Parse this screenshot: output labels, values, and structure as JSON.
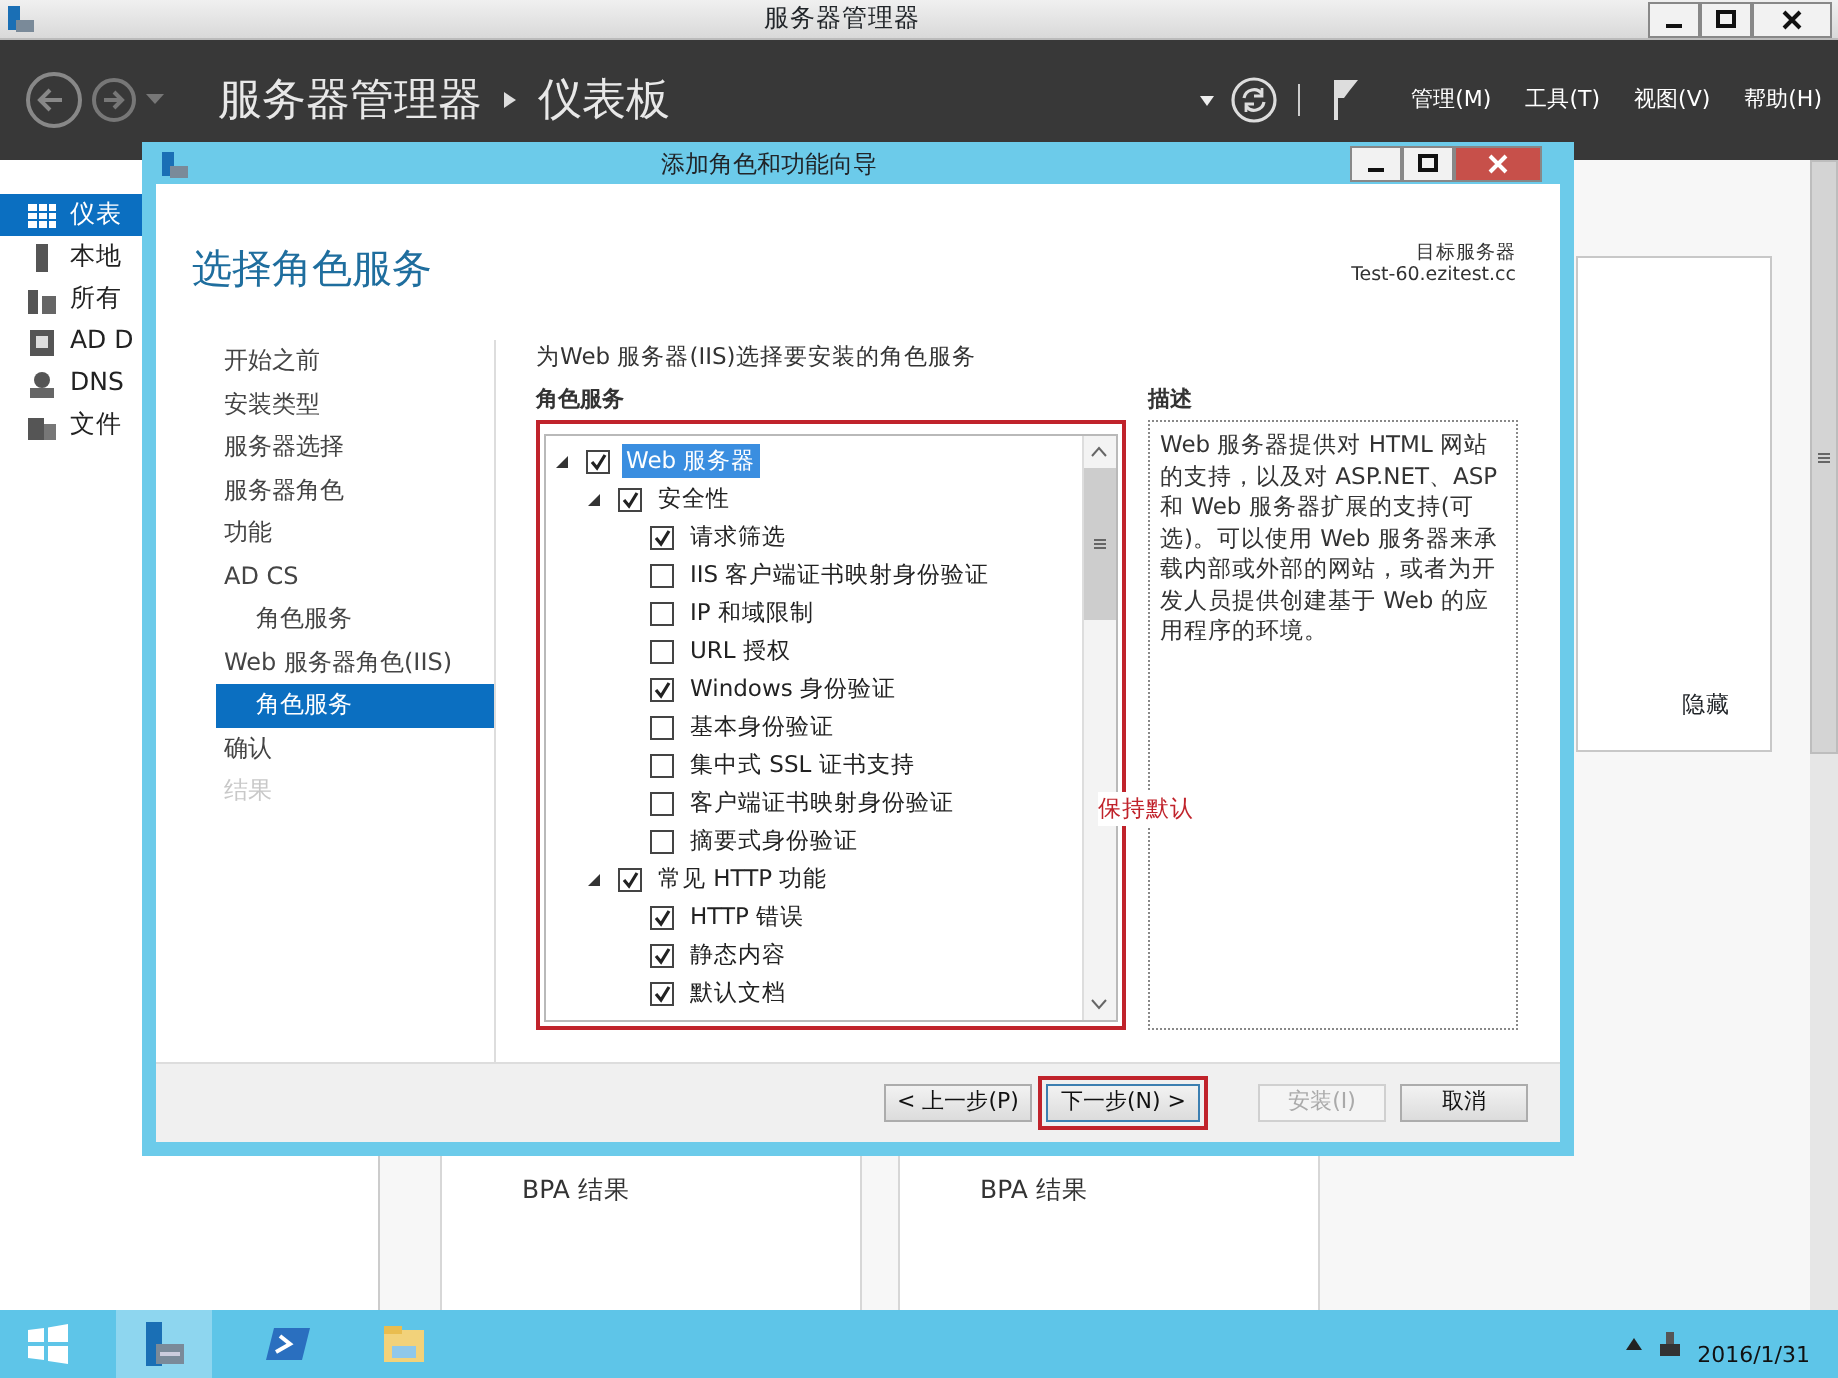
{
  "window": {
    "title": "服务器管理器"
  },
  "header": {
    "breadcrumb": [
      "服务器管理器",
      "仪表板"
    ],
    "menus": [
      "管理(M)",
      "工具(T)",
      "视图(V)",
      "帮助(H)"
    ]
  },
  "sidebar": {
    "items": [
      {
        "label": "仪表",
        "kind": "dashboard",
        "selected": true
      },
      {
        "label": "本地",
        "kind": "server",
        "selected": false
      },
      {
        "label": "所有",
        "kind": "servers",
        "selected": false
      },
      {
        "label": "AD D",
        "kind": "directory",
        "selected": false
      },
      {
        "label": "DNS",
        "kind": "dns",
        "selected": false
      },
      {
        "label": "文件",
        "kind": "files",
        "selected": false
      }
    ]
  },
  "dashboard": {
    "side_panel": {
      "link": "隐藏"
    },
    "tiles": [
      {
        "label": "BPA 结果"
      },
      {
        "label": "BPA 结果"
      }
    ]
  },
  "dialog": {
    "title": "添加角色和功能向导",
    "heading": "选择角色服务",
    "target_label": "目标服务器",
    "target_server": "Test-60.ezitest.cc",
    "steps": [
      {
        "label": "开始之前",
        "selected": false,
        "disabled": false
      },
      {
        "label": "安装类型",
        "selected": false,
        "disabled": false
      },
      {
        "label": "服务器选择",
        "selected": false,
        "disabled": false
      },
      {
        "label": "服务器角色",
        "selected": false,
        "disabled": false
      },
      {
        "label": "功能",
        "selected": false,
        "disabled": false
      },
      {
        "label": "AD CS",
        "selected": false,
        "disabled": false,
        "children": [
          {
            "label": "角色服务",
            "selected": false,
            "disabled": false
          }
        ]
      },
      {
        "label": "Web 服务器角色(IIS)",
        "selected": false,
        "disabled": false,
        "children": [
          {
            "label": "角色服务",
            "selected": true,
            "disabled": false
          }
        ]
      },
      {
        "label": "确认",
        "selected": false,
        "disabled": false
      },
      {
        "label": "结果",
        "selected": false,
        "disabled": true
      }
    ],
    "instruction": "为Web 服务器(IIS)选择要安装的角色服务",
    "roles_heading": "角色服务",
    "role_tree": {
      "highlighted": true,
      "items": [
        {
          "label": "Web 服务器",
          "checked": true,
          "expanded": true,
          "selected": true,
          "children": [
            {
              "label": "安全性",
              "checked": true,
              "expanded": true,
              "selected": false,
              "children": [
                {
                  "label": "请求筛选",
                  "checked": true,
                  "selected": false
                },
                {
                  "label": "IIS 客户端证书映射身份验证",
                  "checked": false,
                  "selected": false
                },
                {
                  "label": "IP 和域限制",
                  "checked": false,
                  "selected": false
                },
                {
                  "label": "URL 授权",
                  "checked": false,
                  "selected": false
                },
                {
                  "label": "Windows 身份验证",
                  "checked": true,
                  "selected": false
                },
                {
                  "label": "基本身份验证",
                  "checked": false,
                  "selected": false
                },
                {
                  "label": "集中式 SSL 证书支持",
                  "checked": false,
                  "selected": false
                },
                {
                  "label": "客户端证书映射身份验证",
                  "checked": false,
                  "selected": false
                },
                {
                  "label": "摘要式身份验证",
                  "checked": false,
                  "selected": false
                }
              ]
            },
            {
              "label": "常见 HTTP 功能",
              "checked": true,
              "expanded": true,
              "selected": false,
              "children": [
                {
                  "label": "HTTP 错误",
                  "checked": true,
                  "selected": false
                },
                {
                  "label": "静态内容",
                  "checked": true,
                  "selected": false
                },
                {
                  "label": "默认文档",
                  "checked": true,
                  "selected": false
                }
              ]
            }
          ]
        }
      ]
    },
    "annotation": "保持默认",
    "description_heading": "描述",
    "description": "Web 服务器提供对 HTML 网站的支持，以及对 ASP.NET、ASP 和 Web 服务器扩展的支持(可选)。可以使用 Web 服务器来承载内部或外部的网站，或者为开发人员提供创建基于 Web 的应用程序的环境。",
    "buttons": [
      {
        "label": "< 上一步(P)",
        "disabled": false,
        "highlighted": false
      },
      {
        "label": "下一步(N) >",
        "disabled": false,
        "highlighted": true
      },
      {
        "label": "安装(I)",
        "disabled": true,
        "highlighted": false
      },
      {
        "label": "取消",
        "disabled": false,
        "highlighted": false
      }
    ]
  },
  "taskbar": {
    "apps": [
      {
        "kind": "start",
        "selected": false
      },
      {
        "kind": "server-manager",
        "selected": true
      },
      {
        "kind": "powershell",
        "selected": false
      },
      {
        "kind": "explorer",
        "selected": false
      }
    ],
    "date": "2016/1/31"
  }
}
